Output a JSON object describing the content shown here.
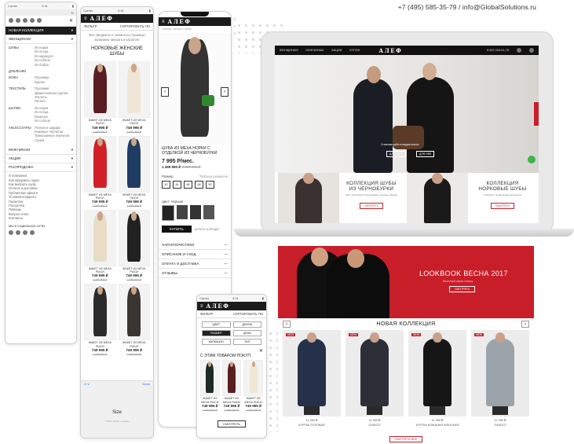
{
  "contact": "+7 (495) 585-35-79 / info@GlobalSolutions.ru",
  "brand": "АЛЕФ",
  "phone1": {
    "status": "Carrier",
    "time": "9:41",
    "menu": [
      {
        "label": "НОВАЯ КОЛЛЕКЦИЯ",
        "dark": true
      },
      {
        "label": "ЖЕНЩИНАМ",
        "dark": false
      }
    ],
    "groups": [
      {
        "name": "ШУБЫ",
        "items": [
          "Из норки",
          "Из песца",
          "Из каракуля",
          "Из соболя",
          "Из бобра"
        ]
      },
      {
        "name": "ДУБЛЕНКИ",
        "items": []
      },
      {
        "name": "КОЖА",
        "items": [
          "Пуховики",
          "Куртки"
        ]
      },
      {
        "name": "ТЕКСТИЛЬ",
        "items": [
          "Пуховики",
          "Демисезонные куртки",
          "Жилеты",
          "Пальто"
        ]
      },
      {
        "name": "ШАПКИ",
        "items": [
          "Из норки",
          "Из песца",
          "Вязаные",
          "Из соболя"
        ]
      },
      {
        "name": "АКСЕССУАРЫ",
        "items": [
          "Платки и шарфы",
          "Кожаные перчатки",
          "Трикотажные перчатки",
          "Сумки"
        ]
      }
    ],
    "sections": [
      "МУЖЧИНАМ",
      "АКЦИИ",
      "РАСПРОДАЖА"
    ],
    "links": [
      "О компании",
      "Как оформить заказ",
      "Как выбрать шубу",
      "Оплата и доставка",
      "Публичная оферта",
      "Условия возврата",
      "Гарантия",
      "Рассрочка",
      "Помощь",
      "Вопрос-ответ",
      "Контакты"
    ],
    "social_label": "Мы в социальных сетях"
  },
  "phone2": {
    "filter_label": "ФИЛЬТР",
    "sort_label": "СОРТИРОВАТЬ ПО",
    "notice": "Все предметы и элементы страницы возможно описать в каталоге",
    "heading": "НОРКОВЫЕ ЖЕНСКИЕ ШУБЫ",
    "products": [
      {
        "title": "ЖАКЕТ ИЗ МЕХА РЫСИ",
        "price": "749 995 ₽",
        "old": "1 499 990 ₽",
        "color": "#5a1d21"
      },
      {
        "title": "ЖАКЕТ ИЗ МЕХА РЫСИ",
        "price": "749 995 ₽",
        "old": "1 499 990 ₽",
        "color": "#efe6d6"
      },
      {
        "title": "ЖАКЕТ ИЗ МЕХА РЫСИ",
        "price": "749 995 ₽",
        "old": "1 499 990 ₽",
        "color": "#d21f28"
      },
      {
        "title": "ЖАКЕТ ИЗ МЕХА РЫСИ",
        "price": "749 995 ₽",
        "old": "1 499 990 ₽",
        "color": "#1f3c63"
      },
      {
        "title": "ЖАКЕТ ИЗ МЕХА РЫСИ",
        "price": "749 995 ₽",
        "old": "1 499 990 ₽",
        "color": "#e8dcc7"
      },
      {
        "title": "ЖАКЕТ ИЗ МЕХА РЫСИ",
        "price": "749 995 ₽",
        "old": "1 499 990 ₽",
        "color": "#222222"
      },
      {
        "title": "ЖАКЕТ ИЗ МЕХА РЫСИ",
        "price": "749 995 ₽",
        "old": "1 499 990 ₽",
        "color": "#2b2b2b"
      },
      {
        "title": "ЖАКЕТ ИЗ МЕХА РЫСИ",
        "price": "749 995 ₽",
        "old": "1 499 990 ₽",
        "color": "#3a3530"
      }
    ],
    "size_label": "Size",
    "done_label": "Done",
    "copyright": "© 2017 Шубы «Алеф»"
  },
  "phone3": {
    "product_title": "ШУБА ИЗ МЕХА НОРКИ С ОТДЕЛКОЙ ИЗ ЧЕРНОБУРКИ",
    "monthly": "7 995 Р/мес.",
    "price": "1 499 990 ₽",
    "old_price": "2 499 900 ₽",
    "size_label": "Размер",
    "size_table": "Таблица размеров",
    "sizes": [
      "42",
      "44",
      "46",
      "48",
      "50"
    ],
    "color_label": "Цвет: Черный",
    "buy": "КУПИТЬ",
    "buy_credit": "КУПИТЬ В КРЕДИТ",
    "accordions": [
      "ХАРАКТЕРИСТИКИ",
      "ОПИСАНИЕ И УХОД",
      "ОПЛАТА И ДОСТАВКА",
      "ОТЗЫВЫ"
    ]
  },
  "phone4": {
    "filter_label": "ФИЛЬТР",
    "sort_label": "СОРТИРОВАТЬ ПО",
    "chips": [
      "ЦВЕТ",
      "ДЛИНА",
      "РАЗМЕР",
      "ЦЕНА",
      "КАПЮШОН",
      "ТИП"
    ],
    "heading": "С ЭТИМ ТОВАРОМ ПОКУП",
    "products": [
      {
        "title": "ЖАКЕТ ИЗ МЕХА РЫСИ",
        "price": "749 995 ₽",
        "old": "1 499 990 ₽",
        "color": "#1e2a24"
      },
      {
        "title": "ЖАКЕТ ИЗ МЕХА РЫСИ",
        "price": "749 995 ₽",
        "old": "1 499 990 ₽",
        "color": "#5a1d21"
      },
      {
        "title": "ЖАКЕТ ИЗ МЕХА РЫСИ",
        "price": "749 995 ₽",
        "old": "1 499 990 ₽",
        "color": "#efe6d6"
      }
    ],
    "footer_btn": "СМОТРЕТЬ"
  },
  "desktop": {
    "nav": [
      "ЖЕНЩИНАМ",
      "МУЖЧИНАМ",
      "АКЦИИ",
      "КУПОН"
    ],
    "phone": "8 800 333-01-78",
    "hero_caption": "Стильная шуба в каждом сезоне",
    "hero_btn1": "ДЛЯ НЕГО",
    "hero_btn2": "ДЛЯ НЕЕ",
    "collections": [
      {
        "title": "КОЛЛЕКЦИЯ ШУБЫ ИЗ ЧЕРНОБУРКИ",
        "sub": "Мех чернобурки подчёркивает роскошь образа",
        "btn": "СМОТРЕТЬ"
      },
      {
        "title": "КОЛЛЕКЦИЯ НОРКОВЫЕ ШУБЫ",
        "sub": "Классика, проверенная временем",
        "btn": "СМОТРЕТЬ"
      }
    ],
    "lookbook_title": "LOOKBOOK ВЕСНА 2017",
    "lookbook_sub": "Весенний образ сезона",
    "lookbook_btn": "СМОТРЕТЬ",
    "new_title": "НОВАЯ КОЛЛЕКЦИЯ",
    "new_items": [
      {
        "badge": "NEW",
        "label": "КУРТКА ПУХОВАЯ",
        "price": "11 950 ₽",
        "color": "#25314b"
      },
      {
        "badge": "NEW",
        "label": "ПАЛЬТО",
        "price": "11 950 ₽",
        "color": "#2d2f38"
      },
      {
        "badge": "NEW",
        "label": "КУРТКА КОЖАНАЯ ЖЕНСКАЯ",
        "price": "11 950 ₽",
        "color": "#161616"
      },
      {
        "badge": "NEW",
        "label": "ПАЛЬТО",
        "price": "11 950 ₽",
        "color": "#9ba4ab"
      }
    ],
    "all_btn": "СМОТРЕТЬ ВСЕ"
  }
}
